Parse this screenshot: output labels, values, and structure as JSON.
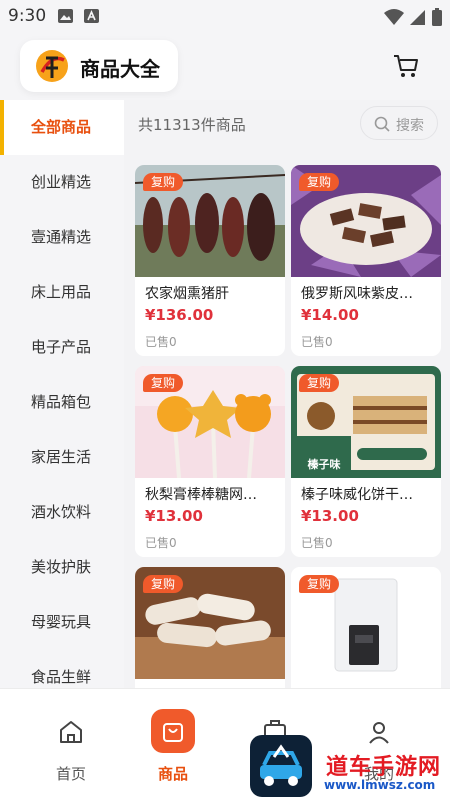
{
  "status_bar": {
    "time": "9:30"
  },
  "header": {
    "title": "商品大全"
  },
  "sidebar": {
    "items": [
      {
        "label": "全部商品",
        "active": true
      },
      {
        "label": "创业精选"
      },
      {
        "label": "壹通精选"
      },
      {
        "label": "床上用品"
      },
      {
        "label": "电子产品"
      },
      {
        "label": "精品箱包"
      },
      {
        "label": "家居生活"
      },
      {
        "label": "酒水饮料"
      },
      {
        "label": "美妆护肤"
      },
      {
        "label": "母婴玩具"
      },
      {
        "label": "食品生鲜"
      }
    ]
  },
  "main": {
    "count": "共11313件商品",
    "search_placeholder": "搜索",
    "products": [
      {
        "tag": "复购",
        "name": "农家烟熏猪肝",
        "price": "¥136.00",
        "sold": "已售0"
      },
      {
        "tag": "复购",
        "name": "俄罗斯风味紫皮…",
        "price": "¥14.00",
        "sold": "已售0"
      },
      {
        "tag": "复购",
        "name": "秋梨膏棒棒糖网…",
        "price": "¥13.00",
        "sold": "已售0"
      },
      {
        "tag": "复购",
        "name": "榛子味威化饼干…",
        "price": "¥13.00",
        "sold": "已售0"
      },
      {
        "tag": "复购"
      },
      {
        "tag": "复购"
      }
    ],
    "product_image_text": {
      "hazelnut_label": "榛子味"
    }
  },
  "bottom_nav": {
    "tabs": [
      {
        "label": "首页"
      },
      {
        "label": "商品",
        "active": true
      },
      {
        "label": ""
      },
      {
        "label": "我的"
      }
    ]
  },
  "watermark": {
    "text": "道车手游网",
    "url": "www.lmwsz.com"
  },
  "colors": {
    "accent": "#e8500f",
    "price": "#e0313b",
    "tag": "#f05a2b",
    "indicator": "#f3b200"
  }
}
